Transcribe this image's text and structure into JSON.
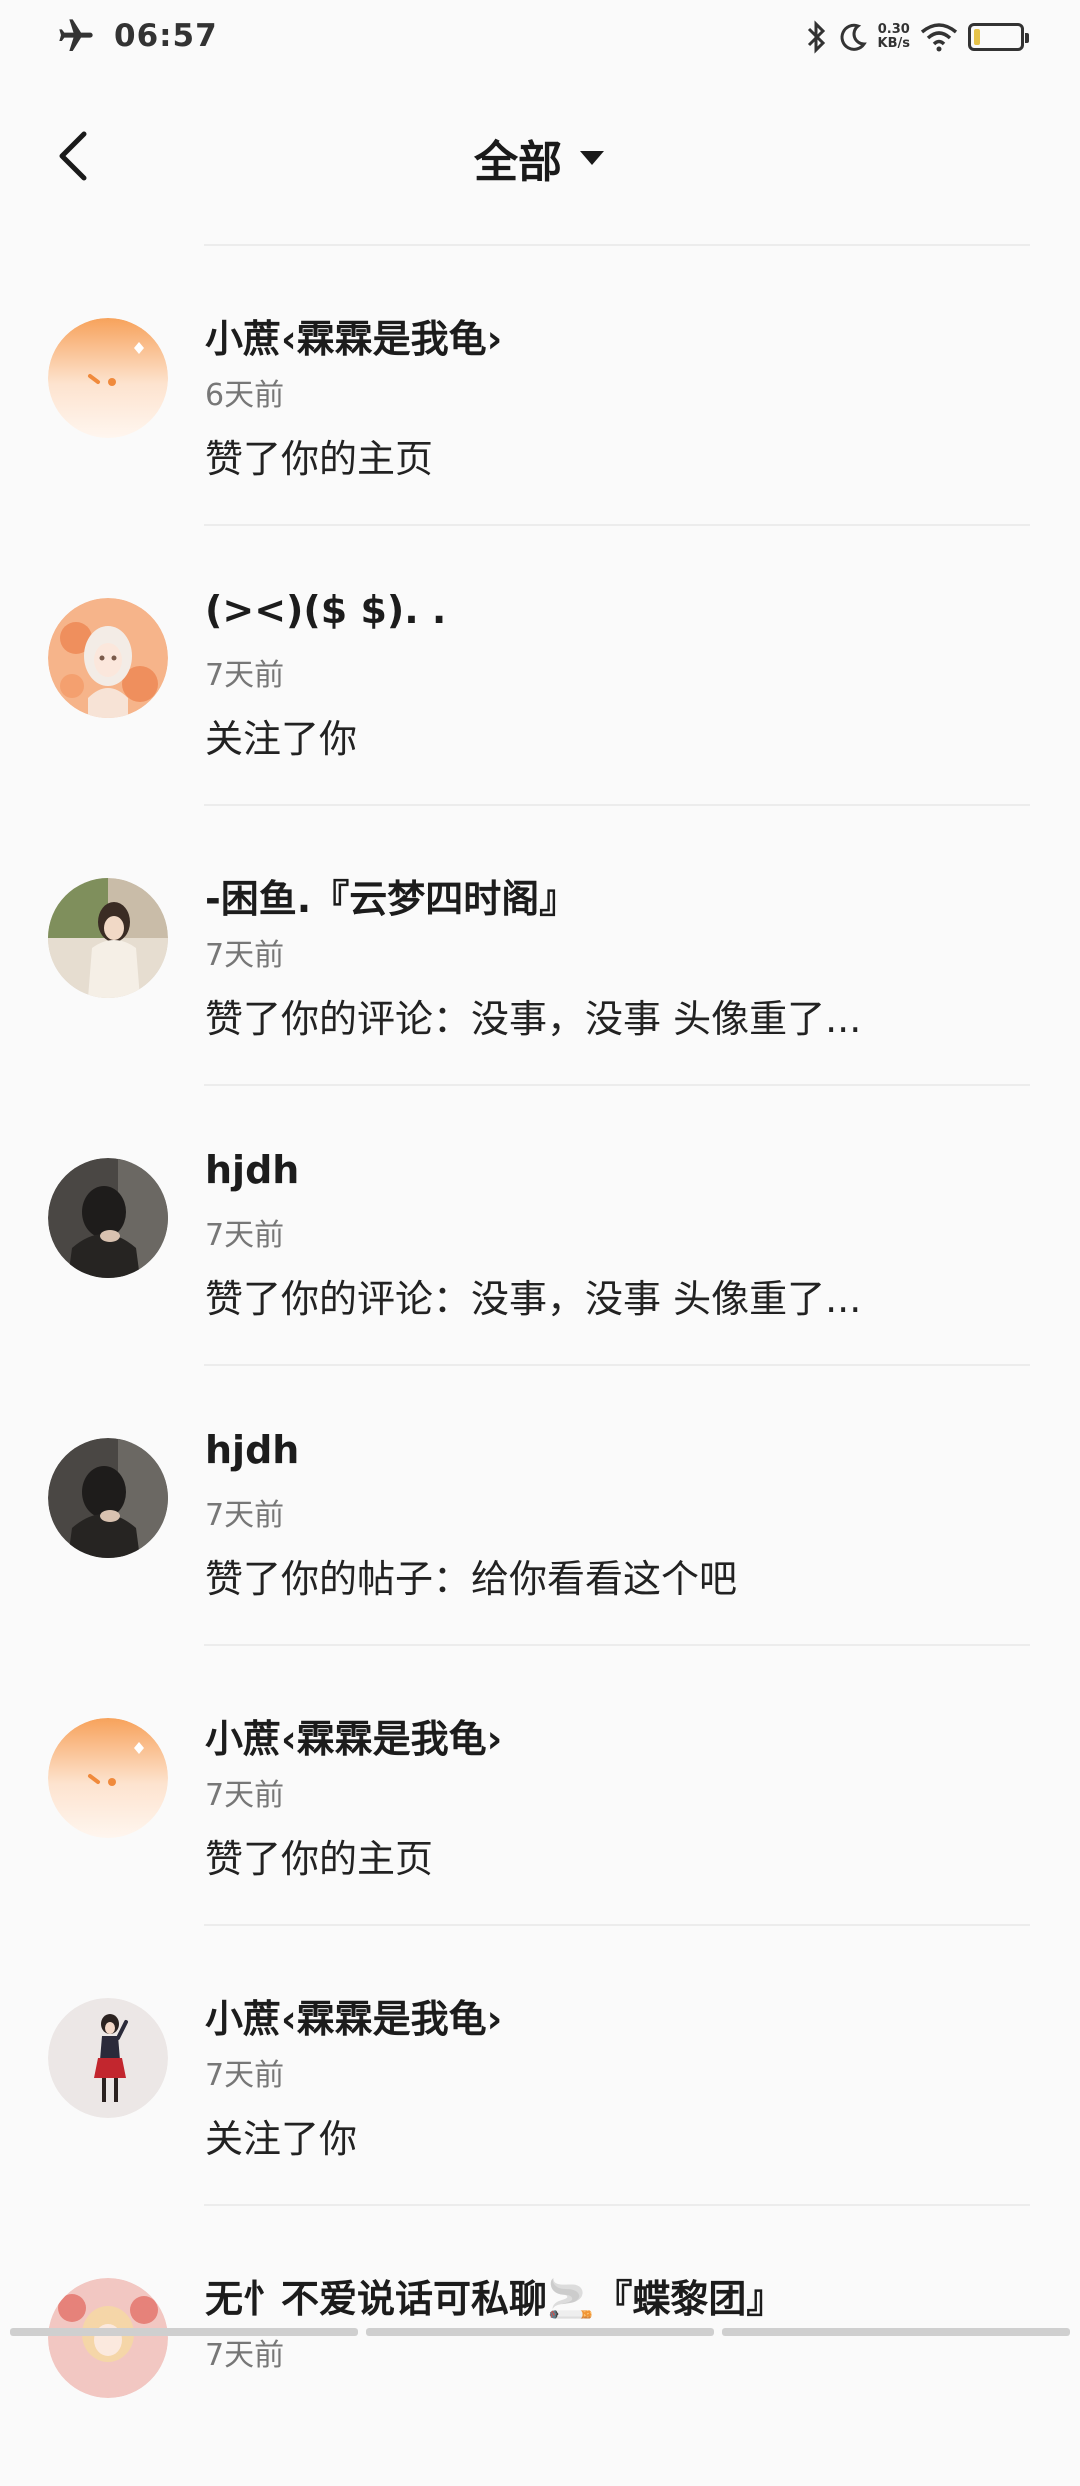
{
  "status_bar": {
    "time": "06:57",
    "net_speed_value": "0.30",
    "net_speed_unit": "KB/s",
    "battery_color": "#e6c34a"
  },
  "header": {
    "title": "全部",
    "back_icon": "chevron-left-icon",
    "dropdown_icon": "caret-down-icon"
  },
  "notifications": [
    {
      "name": "小蔗‹霖霖是我龟›",
      "time": "6天前",
      "action": "赞了你的主页",
      "avatar": "orange-face"
    },
    {
      "name": "(><)($ $).  .",
      "time": "7天前",
      "action": "关注了你",
      "avatar": "anime-girl-orange"
    },
    {
      "name": "-困鱼.『云梦四时阁』",
      "time": "7天前",
      "action": "赞了你的评论：没事，没事 头像重了...",
      "avatar": "photo-girl"
    },
    {
      "name": "hjdh",
      "time": "7天前",
      "action": "赞了你的评论：没事，没事 头像重了...",
      "avatar": "dark-photo"
    },
    {
      "name": "hjdh",
      "time": "7天前",
      "action": "赞了你的帖子：给你看看这个吧",
      "avatar": "dark-photo"
    },
    {
      "name": "小蔗‹霖霖是我龟›",
      "time": "7天前",
      "action": "赞了你的主页",
      "avatar": "orange-face"
    },
    {
      "name": "小蔗‹霖霖是我龟›",
      "time": "7天前",
      "action": "关注了你",
      "avatar": "girl-figure"
    },
    {
      "name": "无忄不爱说话可私聊🚬『蝶黎团』",
      "time": "7天前",
      "action": "",
      "avatar": "anime-girl-pink"
    }
  ]
}
